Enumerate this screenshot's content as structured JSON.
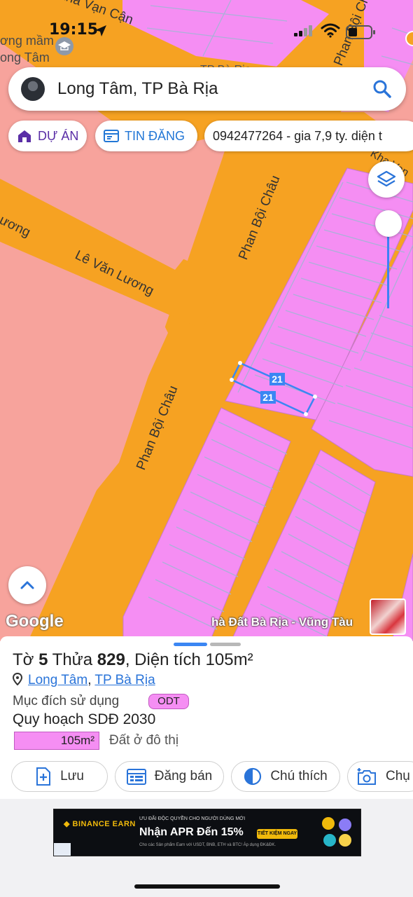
{
  "status_bar": {
    "time": "19:15"
  },
  "search": {
    "query": "Long Tâm, TP Bà Rịa"
  },
  "chips": {
    "du_an": "DỰ ÁN",
    "tin_dang": "TIN ĐĂNG",
    "listing": "0942477264 - gia 7,9 ty. diện t"
  },
  "map": {
    "road_labels": {
      "xuan_van_can": "Xha Vạn Cận",
      "phan_boi_chau_top": "Phan Bội Chá",
      "phan_boi_chau_mid": "Phan Bội Châu",
      "phan_boi_chau_low": "Phan Bội Châu",
      "le_van_luong": "Lê Văn Lương",
      "luong": "ương",
      "kha_van": "Kha Van",
      "ba_ria": "TP Bà Rịa"
    },
    "poi_name": "ơng mầm\nong Tâm",
    "poi_line1": "ơng mầm",
    "poi_line2": "ong Tâm",
    "parcel_label_1": "21",
    "parcel_label_2": "21",
    "google_logo": "Google",
    "attribution": "hà Đất Bà Rịa - Vũng Tàu",
    "colors": {
      "residential": "#f58ef3",
      "road": "#f6a222",
      "zone": "#f7a39c",
      "selection": "#3b86f3"
    }
  },
  "panel": {
    "title_prefix": "Tờ",
    "sheet_number": "5",
    "parcel_word": "Thửa",
    "parcel_number": "829",
    "area_text": ", Diện tích 105m²",
    "ward": "Long Tâm",
    "separator": ",",
    "city": "TP Bà Rịa",
    "purpose_label": "Mục đích sử dụng",
    "purpose_code": "ODT",
    "plan_title": "Quy hoạch SDĐ 2030",
    "plan_area": "105m²",
    "plan_type": "Đất ở đô thị"
  },
  "actions": {
    "save": "Lưu",
    "post_sale": "Đăng bán",
    "legend": "Chú thích",
    "capture": "Chụ"
  },
  "ad": {
    "brand": "◆ BINANCE EARN",
    "small": "ƯU ĐÃI ĐỘC QUYỀN CHO NGƯỜI DÙNG MỚI",
    "headline": "Nhận APR Đến 15%",
    "cta": "TIẾT KIỆM NGAY",
    "fine": "Cho các Sản phẩm Earn với USDT, BNB, ETH và BTC! Áp dụng ĐK&ĐK."
  }
}
